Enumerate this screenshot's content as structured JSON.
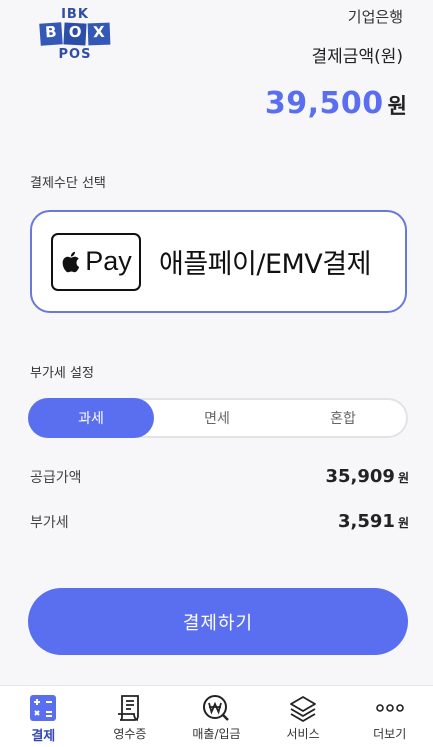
{
  "logo": {
    "line1": "IBK",
    "box_letters": [
      "B",
      "O",
      "X"
    ],
    "line3": "POS"
  },
  "header": {
    "bank_name": "기업은행",
    "amount_label": "결제금액(원)",
    "amount": "39,500",
    "amount_unit": "원"
  },
  "payment_method": {
    "section_title": "결제수단 선택",
    "apple_pay_mark": "Pay",
    "option_label": "애플페이/EMV결제"
  },
  "vat": {
    "section_title": "부가세 설정",
    "options": [
      "과세",
      "면세",
      "혼합"
    ],
    "selected": "과세"
  },
  "summary": {
    "supply_label": "공급가액",
    "supply_value": "35,909",
    "vat_label": "부가세",
    "vat_value": "3,591",
    "unit": "원"
  },
  "pay_button": "결제하기",
  "tabs": [
    {
      "label": "결제",
      "icon": "calculator-icon"
    },
    {
      "label": "영수증",
      "icon": "receipt-icon"
    },
    {
      "label": "매출/입금",
      "icon": "won-coin-search-icon"
    },
    {
      "label": "서비스",
      "icon": "layers-icon"
    },
    {
      "label": "더보기",
      "icon": "more-dots-icon"
    }
  ],
  "colors": {
    "accent": "#5a6ef0",
    "tab_active": "#2f45b8",
    "logo": "#3358b8"
  }
}
